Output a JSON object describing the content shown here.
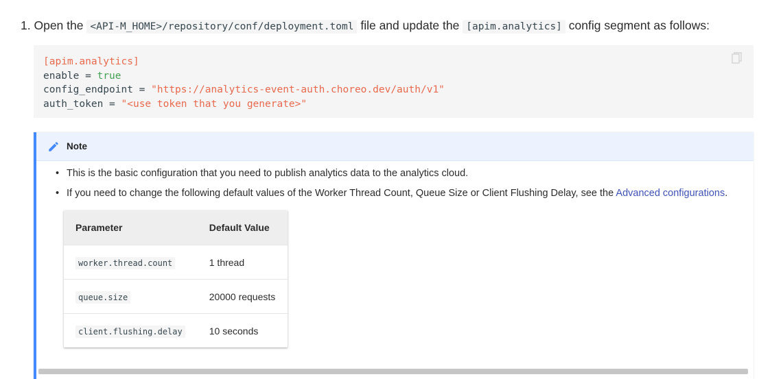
{
  "step": {
    "number": "1.",
    "text_1": "Open the",
    "path": "<API-M_HOME>/repository/conf/deployment.toml",
    "text_2": "file and update the",
    "segment": "[apim.analytics]",
    "text_3": "config segment as follows:"
  },
  "code": {
    "section": "[apim.analytics]",
    "enable_key": "enable = ",
    "enable_value": "true",
    "endpoint_key": "config_endpoint = ",
    "endpoint_value": "\"https://analytics-event-auth.choreo.dev/auth/v1\"",
    "token_key": "auth_token = ",
    "token_value": "\"<use token that you generate>\"",
    "copy_icon": "copy-icon"
  },
  "note": {
    "title": "Note",
    "icon": "pencil-icon",
    "accent_color": "#448aff",
    "bullet_1": "This is the basic configuration that you need to publish analytics data to the analytics cloud.",
    "bullet_2_text": "If you need to change the following default values of the Worker Thread Count, Queue Size or Client Flushing Delay, see the ",
    "bullet_2_link": "Advanced configurations",
    "bullet_2_end": "."
  },
  "table": {
    "headers": [
      "Parameter",
      "Default Value"
    ],
    "rows": [
      {
        "param": "worker.thread.count",
        "value": "1 thread"
      },
      {
        "param": "queue.size",
        "value": "20000 requests"
      },
      {
        "param": "client.flushing.delay",
        "value": "10 seconds"
      }
    ]
  }
}
